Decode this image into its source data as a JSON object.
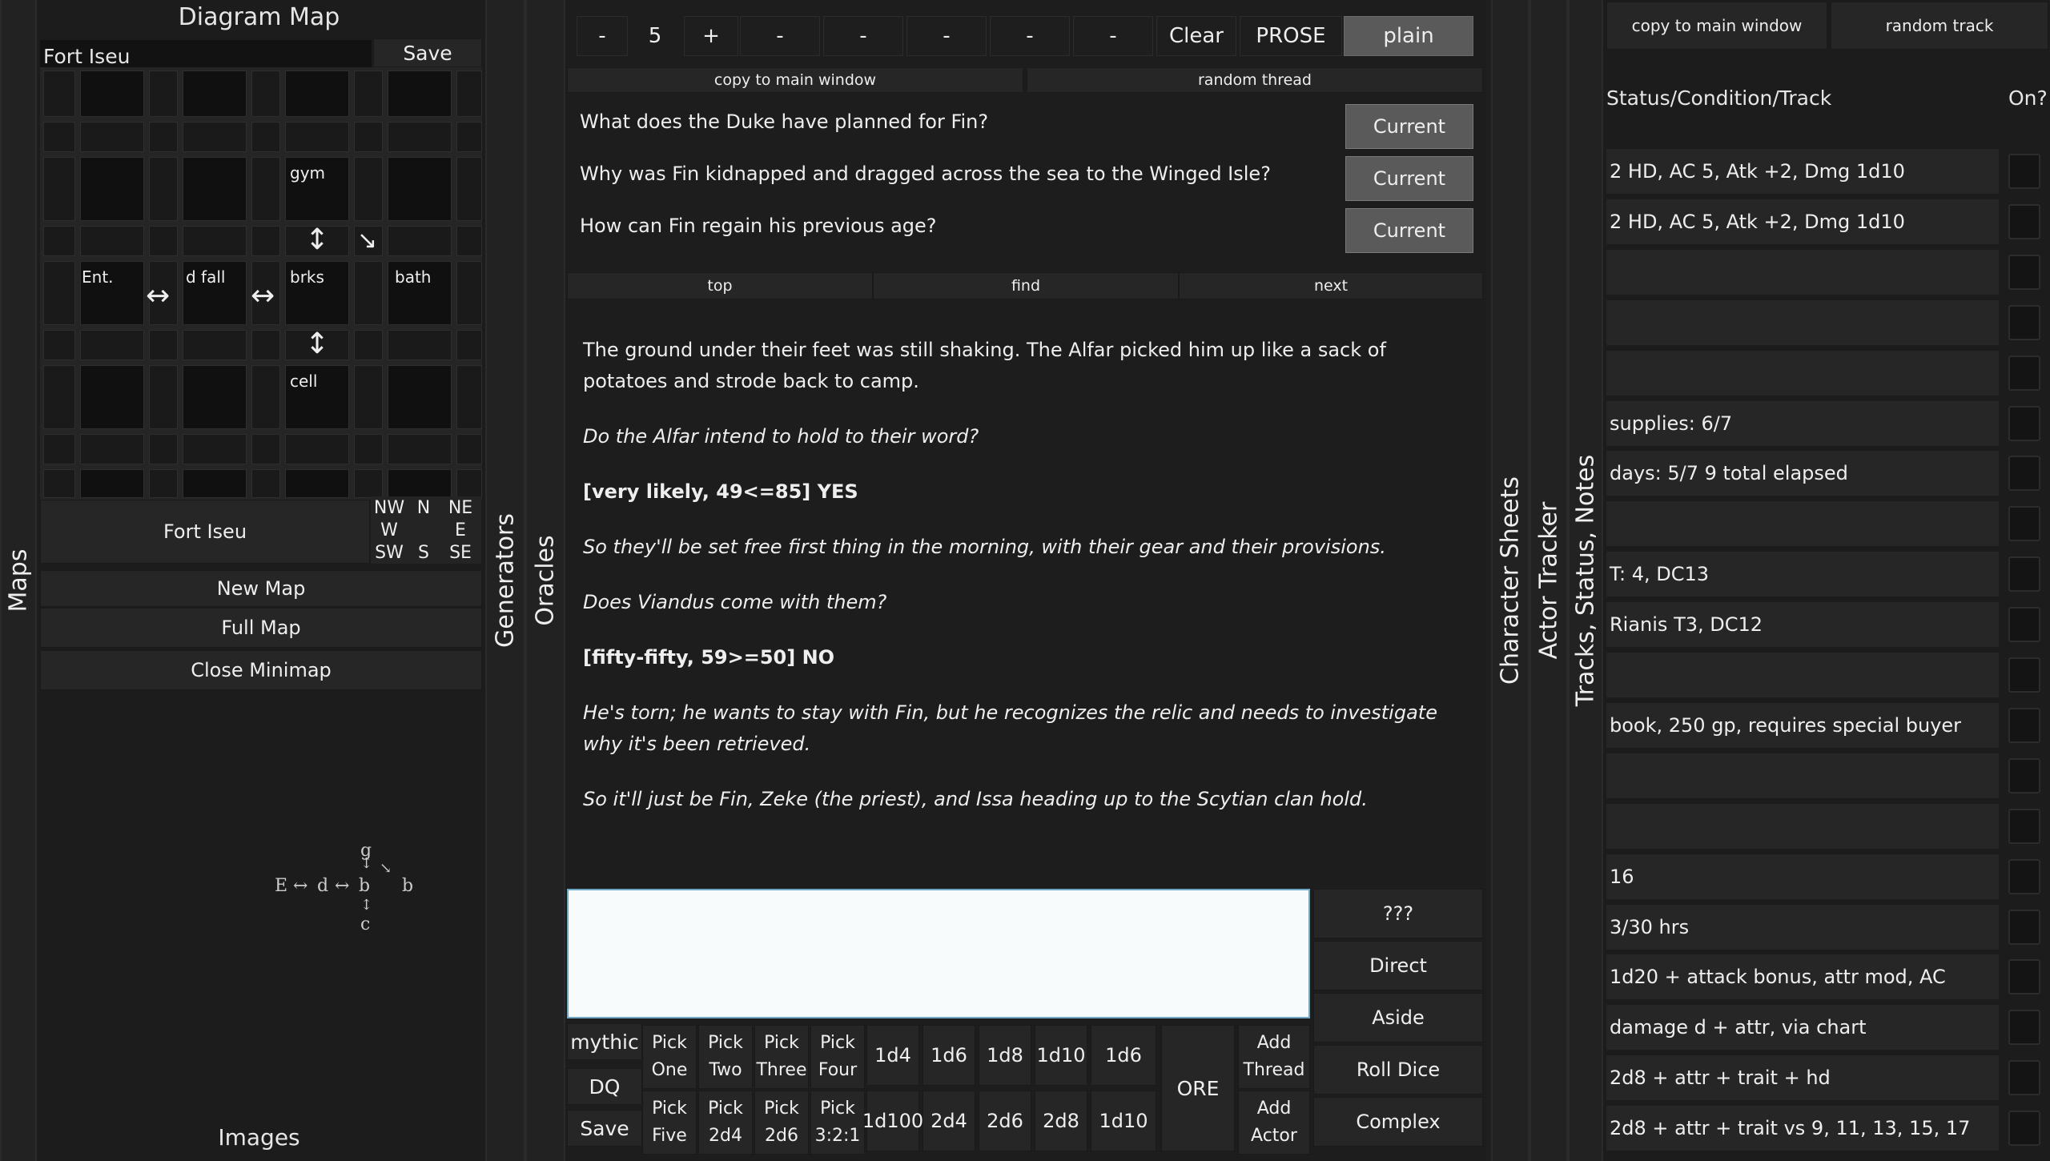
{
  "side_tabs": {
    "maps": "Maps",
    "generators": "Generators",
    "oracles": "Oracles",
    "character_sheets": "Character Sheets",
    "actor_tracker": "Actor Tracker",
    "tracks": "Tracks, Status, Notes"
  },
  "map_panel": {
    "title": "Diagram Map",
    "map_name": "Fort Iseu",
    "save_label": "Save",
    "rooms": {
      "gym": "gym",
      "ent": "Ent.",
      "dfall": "d fall",
      "brks": "brks",
      "bath": "bath",
      "cell": "cell"
    },
    "location_label": "Fort Iseu",
    "compass": [
      "NW",
      "N",
      "NE",
      "W",
      "",
      "E",
      "SW",
      "S",
      "SE"
    ],
    "new_map": "New Map",
    "full_map": "Full Map",
    "close_minimap": "Close Minimap",
    "images": "Images",
    "minimap": {
      "g": "g",
      "e": "E",
      "d": "d",
      "b": "b",
      "b2": "b",
      "c": "c",
      "lr1": "↔",
      "lr2": "↔",
      "ud1": "↕",
      "ud2": "↕",
      "diag": "↘"
    }
  },
  "toolbar": {
    "minus": "-",
    "value": "5",
    "plus": "+",
    "dash": "-",
    "clear": "Clear",
    "prose": "PROSE",
    "plain": "plain",
    "copy_to_main": "copy to main window",
    "random_thread": "random thread"
  },
  "threads": [
    {
      "text": "What does the Duke have planned for Fin?",
      "button": "Current"
    },
    {
      "text": "Why was Fin kidnapped and dragged across the sea to the Winged Isle?",
      "button": "Current"
    },
    {
      "text": "How can Fin regain his previous age?",
      "button": "Current"
    }
  ],
  "nav": {
    "top": "top",
    "find": "find",
    "next": "next"
  },
  "story": [
    {
      "style": "normal",
      "text": "The ground under their feet was still shaking. The Alfar picked him up like a sack of potatoes and strode back to camp."
    },
    {
      "style": "q",
      "text": "Do the Alfar intend to hold to their word?"
    },
    {
      "style": "r",
      "text": "[very likely, 49<=85] YES"
    },
    {
      "style": "q",
      "text": "So they'll be set free first thing in the morning, with their gear and their provisions."
    },
    {
      "style": "q",
      "text": "Does Viandus come with them?"
    },
    {
      "style": "r",
      "text": "[fifty-fifty, 59>=50] NO"
    },
    {
      "style": "q",
      "text": "He's torn; he wants to stay with Fin, but he recognizes the relic and needs to investigate why it's been retrieved."
    },
    {
      "style": "q",
      "text": "So it'll just be Fin, Zeke (the priest), and Issa heading up to the Scytian clan hold."
    }
  ],
  "input": {
    "value": ""
  },
  "action_buttons": {
    "mythic": "mythic",
    "dq": "DQ",
    "save": "Save",
    "pick": "Pick",
    "one": "One",
    "two": "Two",
    "three": "Three",
    "four": "Four",
    "five": "Five",
    "2d4": "2d4",
    "2d6": "2d6",
    "ratio": "3:2:1",
    "dice_top": [
      "1d4",
      "1d6",
      "1d8",
      "1d10",
      "1d6"
    ],
    "dice_bottom": [
      "1d100",
      "2d4",
      "2d6",
      "2d8",
      "1d10"
    ],
    "ore": "ORE",
    "add": "Add",
    "thread": "Thread",
    "actor": "Actor",
    "right": [
      "???",
      "Direct",
      "Aside",
      "Roll Dice",
      "Complex"
    ]
  },
  "tracks_panel": {
    "copy_to_main": "copy to main window",
    "random_track": "random track",
    "header": "Status/Condition/Track",
    "on_header": "On?",
    "rows": [
      "2 HD, AC 5, Atk +2, Dmg 1d10",
      "2 HD, AC 5, Atk +2, Dmg 1d10",
      "",
      "",
      "",
      "supplies: 6/7",
      "days: 5/7      9 total elapsed",
      "",
      "T: 4, DC13",
      "Rianis T3, DC12",
      "",
      "book, 250 gp, requires special buyer",
      "",
      "",
      "16",
      "3/30 hrs",
      "1d20 + attack bonus, attr mod, AC",
      "damage d + attr, via chart",
      "2d8 + attr + trait + hd",
      "2d8 + attr + trait vs 9, 11, 13, 15, 17"
    ]
  }
}
